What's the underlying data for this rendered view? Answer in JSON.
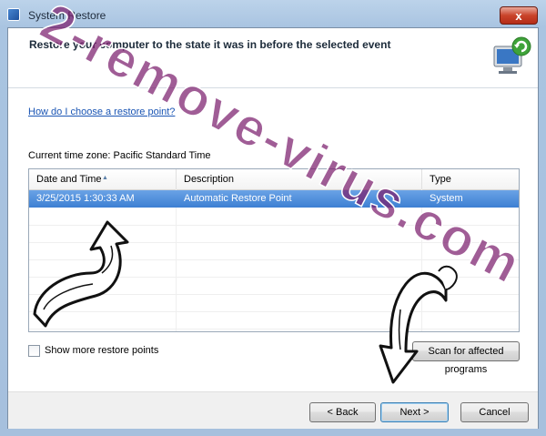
{
  "window": {
    "title": "System Restore",
    "close_glyph": "x"
  },
  "header": {
    "title": "Restore your computer to the state it was in before the selected event",
    "icon": "system-restore-icon"
  },
  "body": {
    "help_link": "How do I choose a restore point?",
    "timezone_label": "Current time zone: Pacific Standard Time"
  },
  "table": {
    "columns": [
      "Date and Time",
      "Description",
      "Type"
    ],
    "rows": [
      {
        "date": "3/25/2015 1:30:33 AM",
        "description": "Automatic Restore Point",
        "type": "System",
        "selected": true
      }
    ]
  },
  "options": {
    "show_more_label": "Show more restore points",
    "show_more_checked": false,
    "scan_button": "Scan for affected programs"
  },
  "footer": {
    "back": "< Back",
    "next": "Next >",
    "cancel": "Cancel"
  },
  "overlay": {
    "watermark_text": "2-remove-virus.com"
  }
}
